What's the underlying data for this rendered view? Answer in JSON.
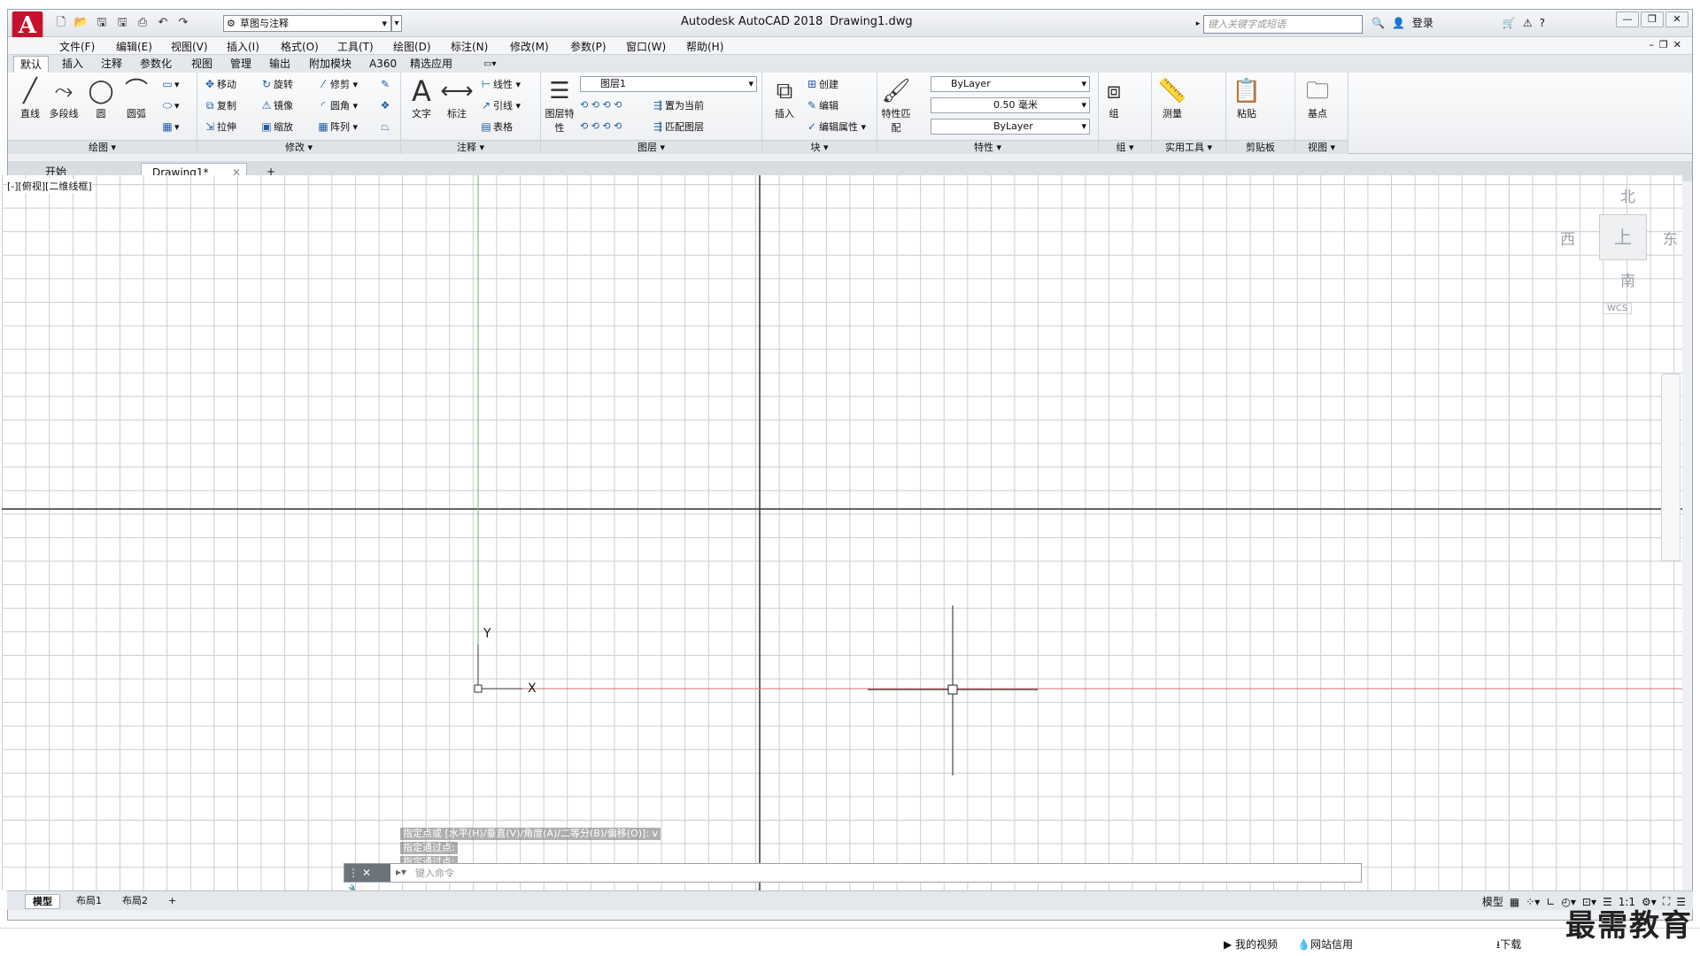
{
  "title": {
    "app": "Autodesk AutoCAD 2018",
    "file": "Drawing1.dwg",
    "workspace": "草图与注释",
    "search_placeholder": "键入关键字或短语",
    "login": "登录"
  },
  "menu": [
    "文件(F)",
    "编辑(E)",
    "视图(V)",
    "插入(I)",
    "格式(O)",
    "工具(T)",
    "绘图(D)",
    "标注(N)",
    "修改(M)",
    "参数(P)",
    "窗口(W)",
    "帮助(H)"
  ],
  "ribbon_tabs": [
    "默认",
    "插入",
    "注释",
    "参数化",
    "视图",
    "管理",
    "输出",
    "附加模块",
    "A360",
    "精选应用"
  ],
  "panels": {
    "draw": {
      "title": "绘图",
      "line": "直线",
      "polyline": "多段线",
      "circle": "圆",
      "arc": "圆弧"
    },
    "modify": {
      "title": "修改",
      "move": "移动",
      "rotate": "旋转",
      "trim": "修剪",
      "copy": "复制",
      "mirror": "镜像",
      "fillet": "圆角",
      "stretch": "拉伸",
      "scale": "缩放",
      "array": "阵列"
    },
    "annotation": {
      "title": "注释",
      "text": "文字",
      "dim": "标注",
      "linear": "线性",
      "leader": "引线",
      "table": "表格"
    },
    "layers": {
      "title": "图层",
      "props": "图层特性",
      "layer_name": "图层1",
      "set_current": "置为当前",
      "match": "匹配图层"
    },
    "block": {
      "title": "块",
      "insert": "插入",
      "create": "创建",
      "edit": "编辑",
      "edit_attr": "编辑属性"
    },
    "properties": {
      "title": "特性",
      "match": "特性匹配",
      "color": "ByLayer",
      "lineweight": "0.50 毫米",
      "linetype": "ByLayer"
    },
    "groups": {
      "title": "组",
      "group": "组"
    },
    "utilities": {
      "title": "实用工具",
      "measure": "测量"
    },
    "clipboard": {
      "title": "剪贴板",
      "paste": "粘贴"
    },
    "view": {
      "title": "视图",
      "base": "基点"
    }
  },
  "doc_tabs": [
    "开始",
    "Drawing1*"
  ],
  "viewport_label": "[-][俯视][二维线框]",
  "viewcube": {
    "n": "北",
    "s": "南",
    "e": "东",
    "w": "西",
    "top": "上",
    "wcs": "WCS"
  },
  "ucs": {
    "x": "X",
    "y": "Y"
  },
  "command": {
    "history": [
      "指定点或 [水平(H)/垂直(V)/角度(A)/二等分(B)/偏移(O)]: v",
      "指定通过点:",
      "指定通过点:"
    ],
    "placeholder": "键入命令"
  },
  "layout_tabs": [
    "模型",
    "布局1",
    "布局2"
  ],
  "status": {
    "model": "模型",
    "scale": "1:1"
  },
  "taskbar": {
    "video": "我的视频",
    "credit": "网站信用",
    "download": "下载"
  },
  "watermark": "最需教育",
  "colors": {
    "accent": "#c8102e",
    "x_axis": "#d07070",
    "y_axis": "#50a050"
  }
}
